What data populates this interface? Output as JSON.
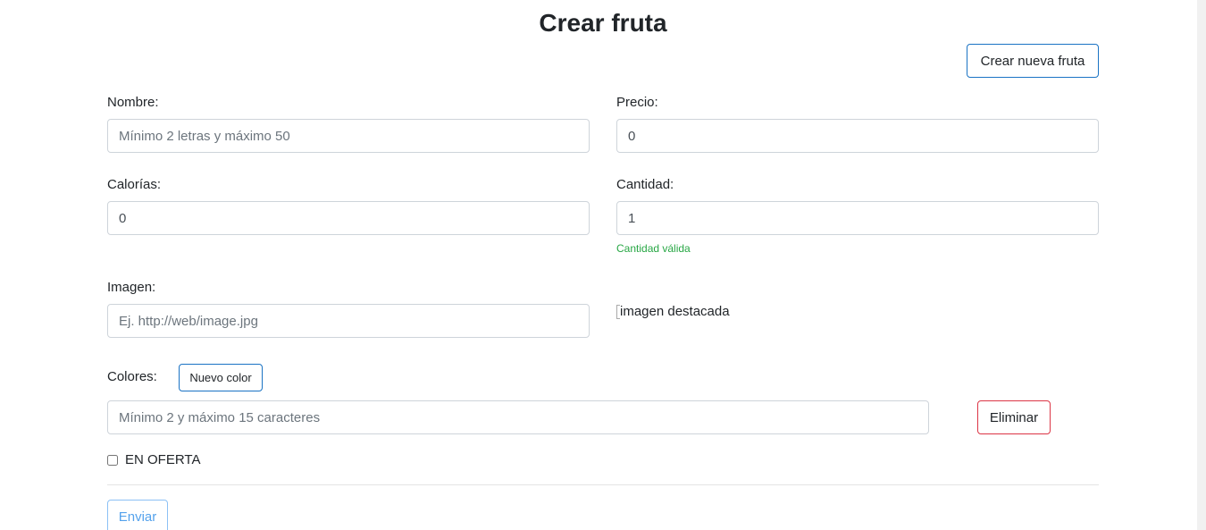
{
  "page": {
    "title": "Crear fruta",
    "create_button": "Crear nueva fruta"
  },
  "form": {
    "nombre": {
      "label": "Nombre:",
      "value": "",
      "placeholder": "Mínimo 2 letras y máximo 50"
    },
    "precio": {
      "label": "Precio:",
      "value": "0",
      "placeholder": ""
    },
    "calorias": {
      "label": "Calorías:",
      "value": "0",
      "placeholder": ""
    },
    "cantidad": {
      "label": "Cantidad:",
      "value": "1",
      "placeholder": "",
      "feedback": "Cantidad válida"
    },
    "imagen": {
      "label": "Imagen:",
      "value": "",
      "placeholder": "Ej. http://web/image.jpg",
      "preview_alt": "imagen destacada"
    },
    "colores": {
      "label": "Colores:",
      "add_button": "Nuevo color",
      "value": "",
      "placeholder": "Mínimo 2 y máximo 15 caracteres",
      "remove_button": "Eliminar"
    },
    "oferta": {
      "label": "EN OFERTA",
      "checked": false
    },
    "submit_button": "Enviar"
  },
  "colors": {
    "primary": "#007bff",
    "danger": "#dc3545",
    "success": "#28a745"
  }
}
